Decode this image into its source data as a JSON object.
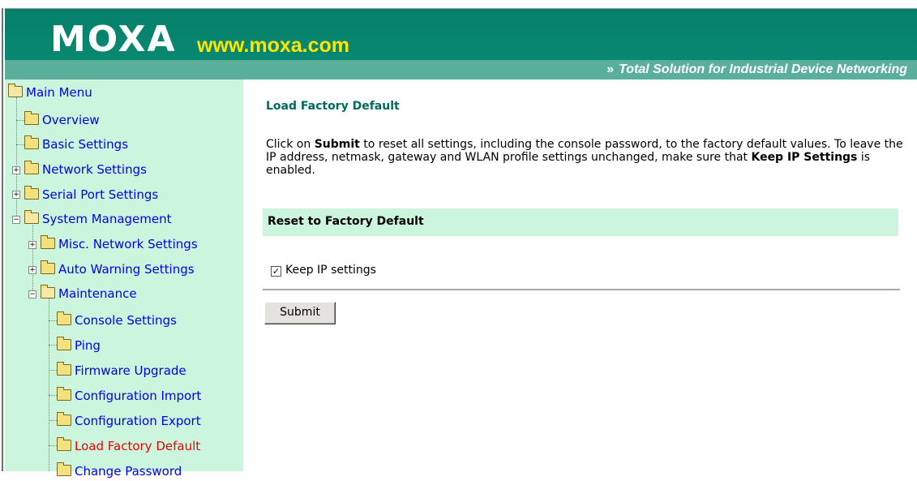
{
  "header": {
    "logo": "MOXA",
    "url": "www.moxa.com",
    "tagline_chevron": "»",
    "tagline": "Total Solution for Industrial Device Networking"
  },
  "sidebar": {
    "items": [
      {
        "label": "Main Menu"
      },
      {
        "label": "Overview"
      },
      {
        "label": "Basic Settings"
      },
      {
        "label": "Network Settings"
      },
      {
        "label": "Serial Port Settings"
      },
      {
        "label": "System Management"
      },
      {
        "label": "Misc. Network Settings"
      },
      {
        "label": "Auto Warning Settings"
      },
      {
        "label": "Maintenance"
      },
      {
        "label": "Console Settings"
      },
      {
        "label": "Ping"
      },
      {
        "label": "Firmware Upgrade"
      },
      {
        "label": "Configuration Import"
      },
      {
        "label": "Configuration Export"
      },
      {
        "label": "Load Factory Default"
      },
      {
        "label": "Change Password"
      }
    ],
    "active_item": "Load Factory Default",
    "link_color": "#0000ee",
    "active_color": "#ee0000"
  },
  "main": {
    "title": "Load Factory Default",
    "desc": {
      "p1": "Click on ",
      "b1": "Submit",
      "p2": " to reset all settings, including the console password, to the factory default values. To leave the IP address, netmask, gateway and WLAN profile settings unchanged, make sure that ",
      "b2": "Keep IP Settings",
      "p3": " is enabled."
    },
    "section_title": "Reset to Factory Default",
    "checkbox_label": "Keep IP settings",
    "checkbox_checked": true,
    "checkbox_mark": "✓",
    "submit_label": "Submit"
  },
  "colors": {
    "header_green": "#08876f",
    "url_yellow": "#ffe600",
    "sidebar_bg": "#ccf5dd",
    "title_teal": "#006b5a"
  }
}
